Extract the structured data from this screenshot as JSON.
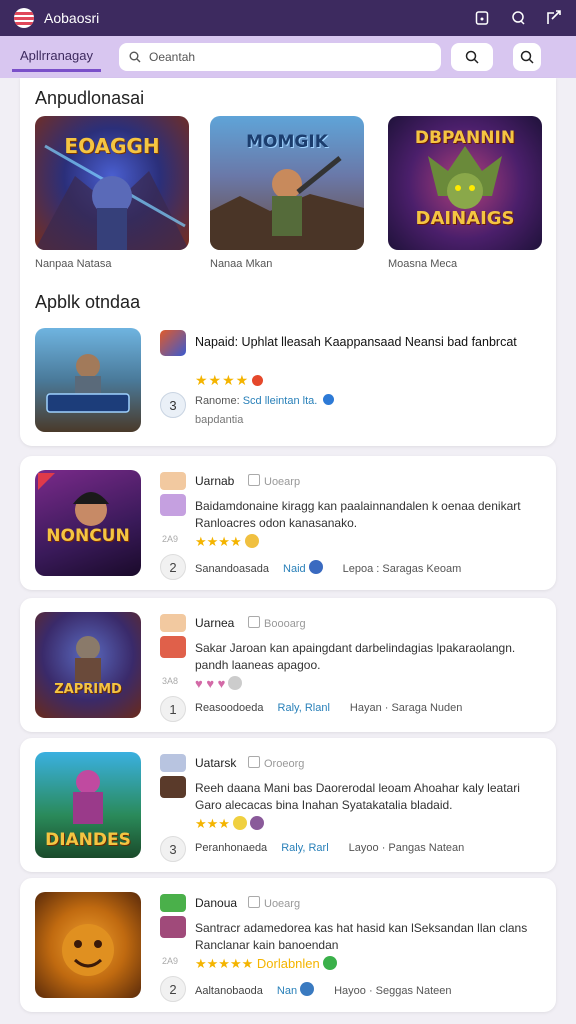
{
  "topbar": {
    "title": "Aobaosri",
    "icons": [
      "notification-icon",
      "profile-icon",
      "share-icon"
    ]
  },
  "subbar": {
    "tab_label": "Apllrranagay",
    "search_placeholder": "Oeantah"
  },
  "featured": {
    "heading": "Anpudlonasai",
    "items": [
      {
        "title_art": "EOAGGH",
        "caption": "Nanpaa Natasa"
      },
      {
        "title_art": "MOMGIK",
        "caption": "Nanaa Mkan"
      },
      {
        "title_art": "DBPANNIN",
        "subtitle_art": "DAINAIGS",
        "caption": "Moasna Meca"
      }
    ]
  },
  "list": {
    "heading": "Apblk otndaa",
    "top_item": {
      "title": "Napaid: Uphlat lleasah Kaappansaad Neansi bad fanbrcat",
      "stars": "★★★★",
      "rank": "3",
      "meta_prefix": "Ranome:",
      "meta_link": "Scd lleintan lta.",
      "meta2": "bapdantia"
    },
    "cards": [
      {
        "name": "Uarnab",
        "tag": "Uoearp",
        "desc": "Baidamdonaine kiragg kan paalainnandalen k oenaa denikart Ranloacres odon kanasanako.",
        "stars": "★★★★",
        "rank": "2",
        "meta": "Sanandoasada",
        "highlight": "Naid",
        "right": "Lepoa : Saragas Keoam",
        "side": "2A9",
        "art": "NONCUN"
      },
      {
        "name": "Uarnea",
        "tag": "Boooarg",
        "desc": "Sakar Jaroan kan apaingdant darbelindagias lpakaraolangn. pandh laaneas apagoo.",
        "stars": "♥ ♥ ♥",
        "rank": "1",
        "meta": "Reasoodoeda",
        "highlight": "Raly, Rlanl",
        "right": "Hayan · Saraga Nuden",
        "side": "3A8",
        "art": "ZAPRIMD"
      },
      {
        "name": "Uatarsk",
        "tag": "Oroeorg",
        "desc": "Reeh daana Mani bas Daorerodal leoam Ahoahar kaly leatari Garo alecacas bina Inahan Syatakatalia bladaid.",
        "stars": "★★★",
        "rank": "3",
        "meta": "Peranhonaeda",
        "highlight": "Raly, Rarl",
        "right": "Layoo · Pangas Natean",
        "side": "",
        "art": "DIANDES"
      },
      {
        "name": "Danoua",
        "tag": "Uoearg",
        "desc": "Santracr adamedorea kas hat hasid kan lSeksandan llan clans Ranclanar kain banoendan",
        "stars": "★★★★★ Dorlabnlen",
        "rank": "2",
        "meta": "Aaltanobaoda",
        "highlight": "Nan",
        "right": "Hayoo · Seggas Nateen",
        "side": "2A9",
        "art": ""
      }
    ]
  },
  "colors": {
    "topbar": "#3d2a5f",
    "subbar": "#d8c6f0",
    "accent": "#7a4fc9",
    "star": "#f4b400",
    "link": "#2980b9"
  }
}
